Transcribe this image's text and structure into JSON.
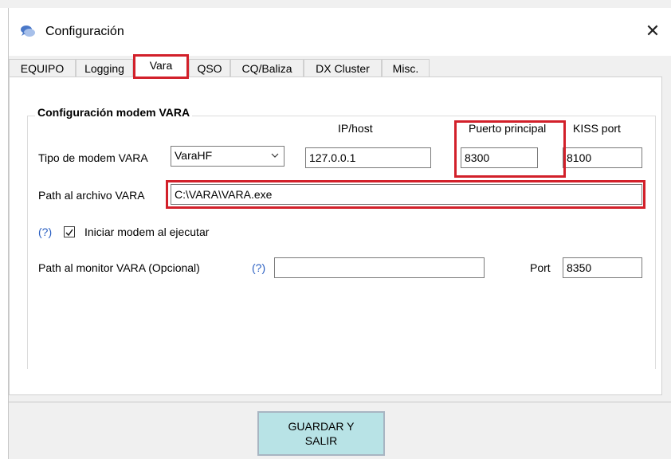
{
  "window": {
    "title": "Configuración",
    "close_glyph": "✕"
  },
  "tabs": [
    {
      "label": "EQUIPO"
    },
    {
      "label": "Logging"
    },
    {
      "label": "Vara"
    },
    {
      "label": "QSO"
    },
    {
      "label": "CQ/Baliza"
    },
    {
      "label": "DX Cluster"
    },
    {
      "label": "Misc."
    }
  ],
  "active_tab": "Vara",
  "vara": {
    "group_title": "Configuración modem VARA",
    "col_ip": "IP/host",
    "col_puerto": "Puerto principal",
    "col_kiss": "KISS port",
    "tipo_label": "Tipo de modem VARA",
    "tipo_value": "VaraHF",
    "ip_value": "127.0.0.1",
    "puerto_value": "8300",
    "kiss_value": "8100",
    "path_label": "Path al archivo VARA",
    "path_value": "C:\\VARA\\VARA.exe",
    "help_text": "(?)",
    "iniciar_label": "Iniciar modem al ejecutar",
    "iniciar_checked": true,
    "monitor_label": "Path al monitor VARA (Opcional)",
    "monitor_value": "",
    "port_label": "Port",
    "port_value": "8350"
  },
  "save_button": {
    "line1": "GUARDAR Y",
    "line2": "SALIR"
  },
  "colors": {
    "highlight": "#d2202a",
    "save_bg": "#b8e3e6",
    "link": "#2a5fc2"
  },
  "icons": {
    "app": "chat-bubbles-icon",
    "close": "close-icon",
    "dropdown": "chevron-down-icon",
    "check": "checkmark-icon"
  }
}
